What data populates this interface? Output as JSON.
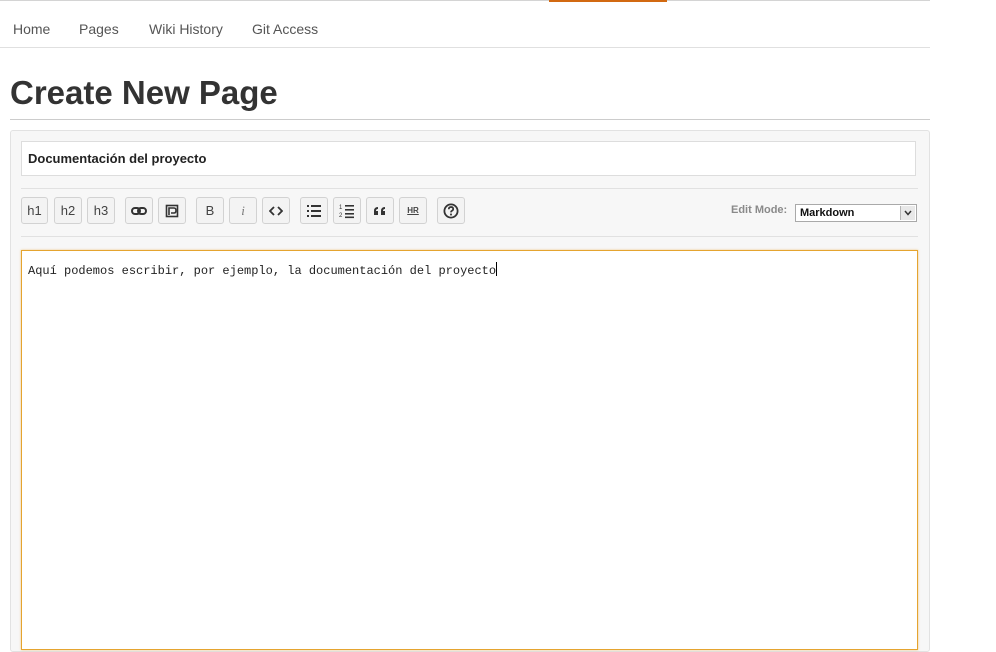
{
  "nav": {
    "items": [
      {
        "label": "Home"
      },
      {
        "label": "Pages"
      },
      {
        "label": "Wiki History"
      },
      {
        "label": "Git Access"
      }
    ]
  },
  "page": {
    "title": "Create New Page"
  },
  "editor": {
    "page_name_value": "Documentación del proyecto",
    "toolbar": {
      "h1": "h1",
      "h2": "h2",
      "h3": "h3",
      "link_icon": "link-icon",
      "image_icon": "image-icon",
      "bold": "B",
      "italic": "i",
      "code_icon": "code-icon",
      "ul_icon": "unordered-list-icon",
      "ol_icon": "ordered-list-icon",
      "quote_icon": "blockquote-icon",
      "hr": "HR",
      "help_icon": "help-icon"
    },
    "edit_mode": {
      "label": "Edit Mode:",
      "selected": "Markdown"
    },
    "content": "Aquí podemos escribir, por ejemplo, la documentación del proyecto"
  },
  "colors": {
    "accent": "#d26911",
    "focus_border": "#e5a42f"
  }
}
